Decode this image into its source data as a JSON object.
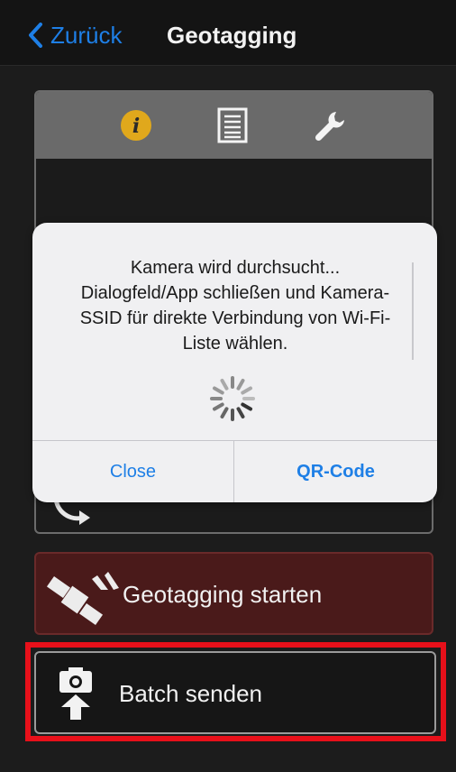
{
  "nav": {
    "back_label": "Zurück",
    "title": "Geotagging"
  },
  "panel": {
    "tabs": [
      {
        "name": "info",
        "icon": "info-icon"
      },
      {
        "name": "list",
        "icon": "list-icon"
      },
      {
        "name": "settings",
        "icon": "wrench-icon"
      }
    ]
  },
  "actions": {
    "geotag_label": "Geotagging starten",
    "batch_label": "Batch senden"
  },
  "dialog": {
    "message_line1": "Kamera wird durchsucht...",
    "message_line2": "Dialogfeld/App schließen und Kamera-",
    "message_line3": "SSID für direkte Verbindung von Wi-Fi-",
    "message_line4": "Liste wählen.",
    "close_label": "Close",
    "qr_label": "QR-Code"
  },
  "colors": {
    "accent": "#1e7fe6",
    "info_icon": "#e0a81c",
    "highlight": "#e8101a"
  }
}
